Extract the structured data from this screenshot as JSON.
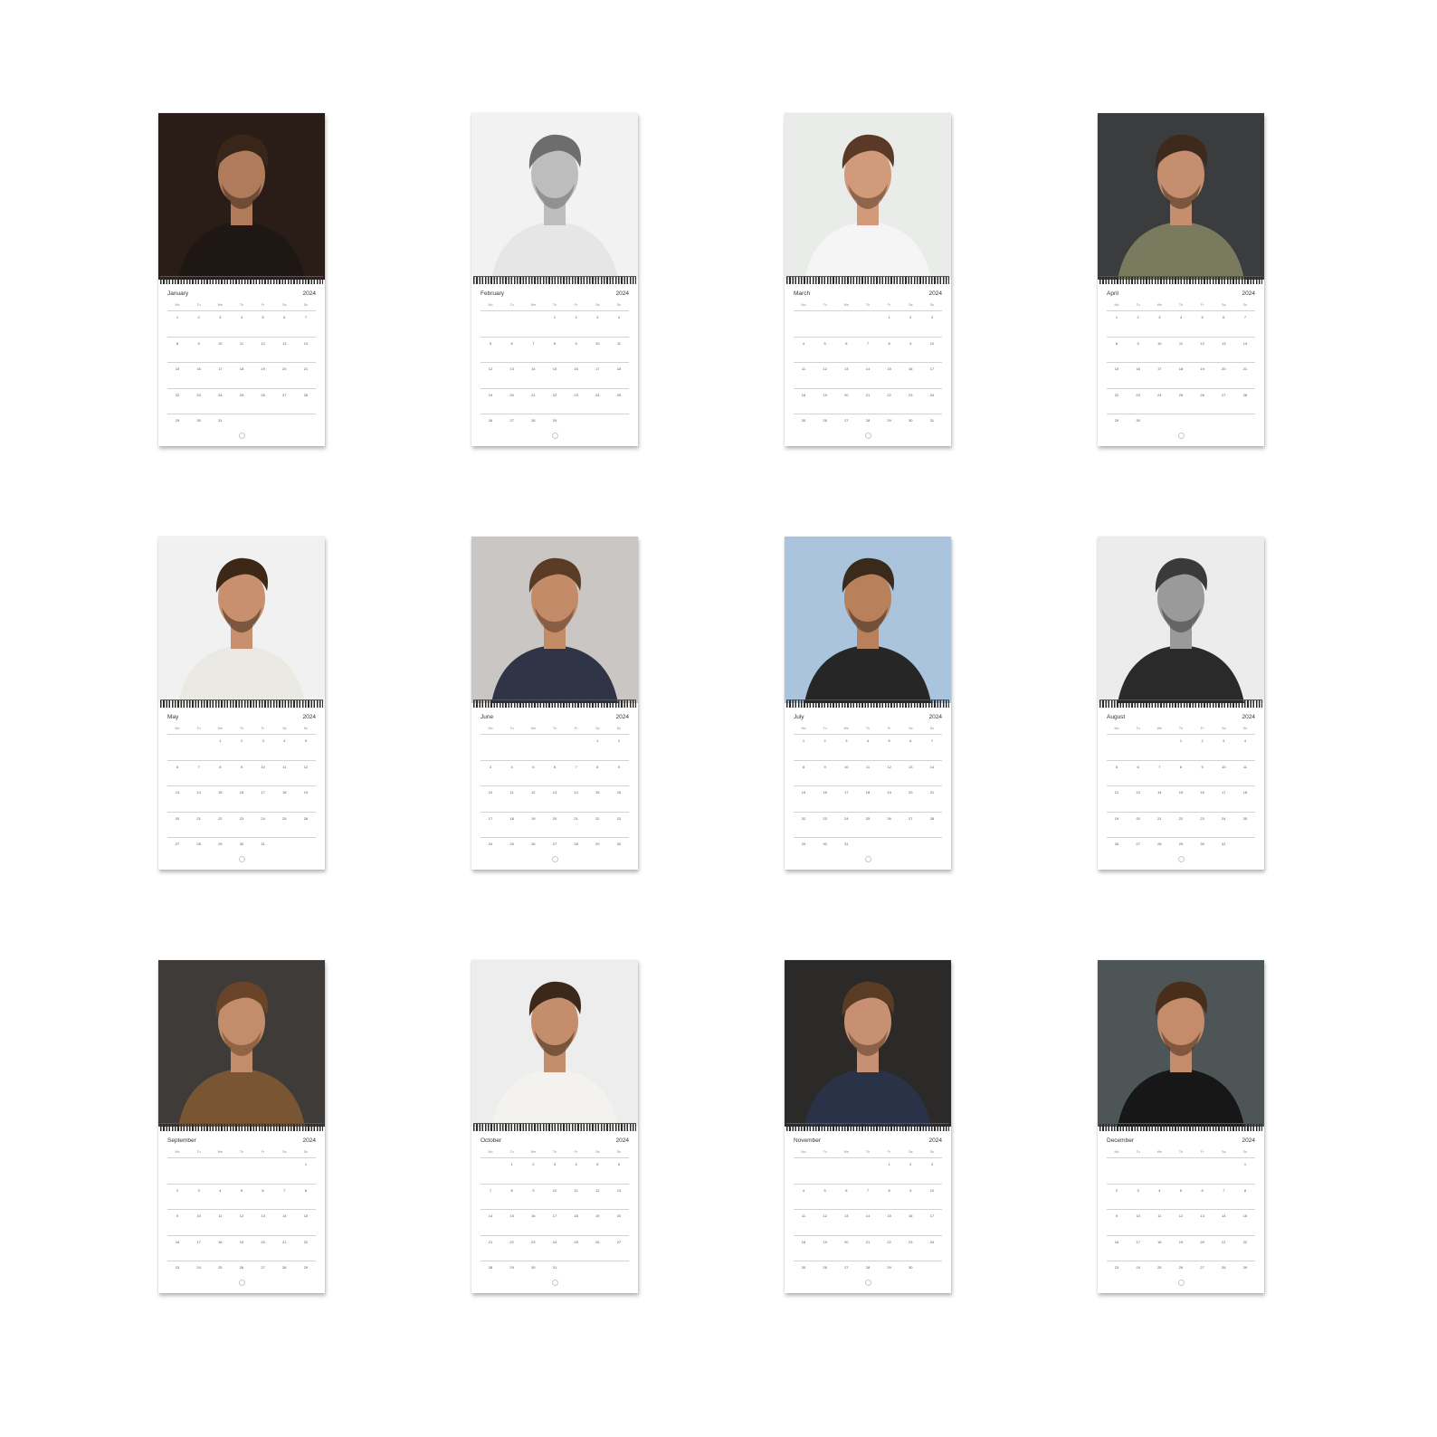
{
  "calendar": {
    "year": "2024",
    "weekday_labels": [
      "Mo",
      "Tu",
      "We",
      "Th",
      "Fr",
      "Sa",
      "Su"
    ],
    "months": [
      {
        "name": "January",
        "start": 0,
        "days": 31,
        "photo": {
          "bg": "#2a1d18",
          "shirt": "#1e1714",
          "skin": "#b07b5b",
          "hair": "#3a2618"
        }
      },
      {
        "name": "February",
        "start": 3,
        "days": 29,
        "photo": {
          "bg": "#f2f2f2",
          "shirt": "#e6e6e6",
          "skin": "#bdbdbd",
          "hair": "#6d6d6d"
        }
      },
      {
        "name": "March",
        "start": 4,
        "days": 31,
        "photo": {
          "bg": "#e9ece8",
          "shirt": "#f5f5f5",
          "skin": "#d19a7a",
          "hair": "#5a3a26"
        }
      },
      {
        "name": "April",
        "start": 0,
        "days": 30,
        "photo": {
          "bg": "#3b3c3e",
          "shirt": "#7a7a5e",
          "skin": "#c58e6e",
          "hair": "#3e2a1c"
        }
      },
      {
        "name": "May",
        "start": 2,
        "days": 31,
        "photo": {
          "bg": "#f1f1f1",
          "shirt": "#ebe9e4",
          "skin": "#c8906e",
          "hair": "#3d2818"
        }
      },
      {
        "name": "June",
        "start": 5,
        "days": 30,
        "photo": {
          "bg": "#c9c6c3",
          "shirt": "#2f3447",
          "skin": "#c48b69",
          "hair": "#5a3b26"
        }
      },
      {
        "name": "July",
        "start": 0,
        "days": 31,
        "photo": {
          "bg": "#a9c4dc",
          "shirt": "#262626",
          "skin": "#b9805c",
          "hair": "#3a2a1c"
        }
      },
      {
        "name": "August",
        "start": 3,
        "days": 31,
        "photo": {
          "bg": "#ececec",
          "shirt": "#2a2a2a",
          "skin": "#9a9a9a",
          "hair": "#3a3a3a"
        }
      },
      {
        "name": "September",
        "start": 6,
        "days": 30,
        "photo": {
          "bg": "#3f3b38",
          "shirt": "#7a5534",
          "skin": "#c38c6a",
          "hair": "#6a4428"
        }
      },
      {
        "name": "October",
        "start": 1,
        "days": 31,
        "photo": {
          "bg": "#ededed",
          "shirt": "#f4f2ee",
          "skin": "#c48d6c",
          "hair": "#3c2818"
        }
      },
      {
        "name": "November",
        "start": 4,
        "days": 30,
        "photo": {
          "bg": "#2b2a29",
          "shirt": "#2a3247",
          "skin": "#c79072",
          "hair": "#5a3b24"
        }
      },
      {
        "name": "December",
        "start": 6,
        "days": 31,
        "photo": {
          "bg": "#4e5557",
          "shirt": "#171717",
          "skin": "#c48c6a",
          "hair": "#4a2e1c"
        }
      }
    ]
  }
}
